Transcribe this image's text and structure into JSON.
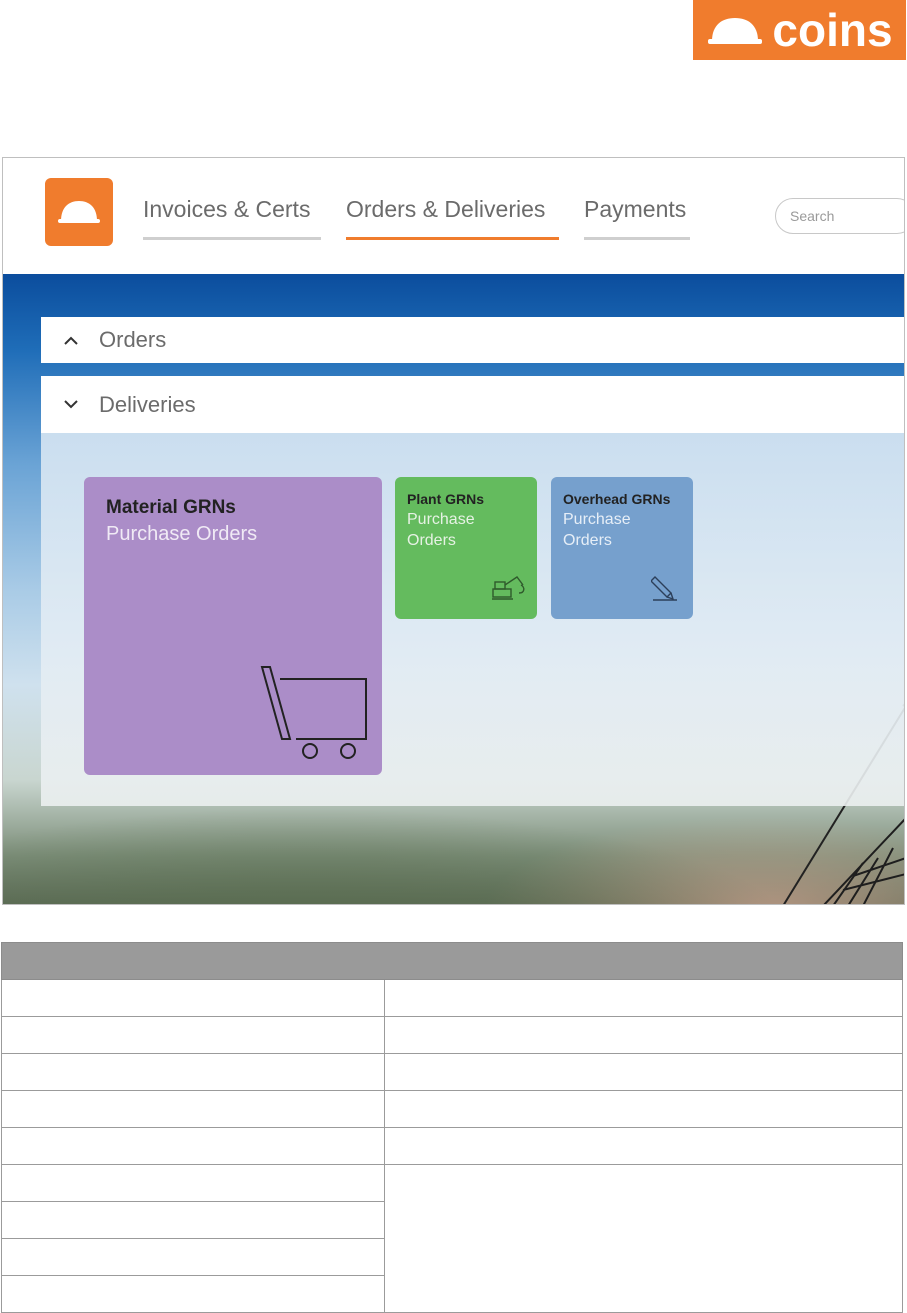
{
  "brand": {
    "name": "coins",
    "color": "#f07c2d"
  },
  "nav": {
    "items": [
      {
        "label": "Invoices & Certs",
        "active": false
      },
      {
        "label": "Orders & Deliveries",
        "active": true
      },
      {
        "label": "Payments",
        "active": false
      }
    ],
    "search_placeholder": "Search"
  },
  "panels": {
    "orders": {
      "title": "Orders",
      "expanded": false,
      "icon": "chevron-up-icon"
    },
    "deliveries": {
      "title": "Deliveries",
      "expanded": true,
      "icon": "chevron-down-icon"
    }
  },
  "tiles": [
    {
      "title": "Material GRNs",
      "subtitle": "Purchase Orders",
      "color": "#ab8dc8",
      "icon": "shopping-cart-icon"
    },
    {
      "title": "Plant GRNs",
      "subtitle": "Purchase Orders",
      "color": "#64bb5e",
      "icon": "excavator-icon"
    },
    {
      "title": "Overhead GRNs",
      "subtitle": "Purchase Orders",
      "color": "#76a0cd",
      "icon": "pencil-icon"
    }
  ],
  "colors": {
    "accent": "#f07c2d",
    "table_header": "#9a9a9a"
  },
  "table": {
    "header": [
      ""
    ],
    "rows": [
      [
        "",
        ""
      ],
      [
        "",
        ""
      ],
      [
        "",
        ""
      ],
      [
        "",
        ""
      ],
      [
        "",
        ""
      ],
      [
        "",
        ""
      ],
      [
        ""
      ],
      [
        ""
      ],
      [
        ""
      ]
    ]
  }
}
